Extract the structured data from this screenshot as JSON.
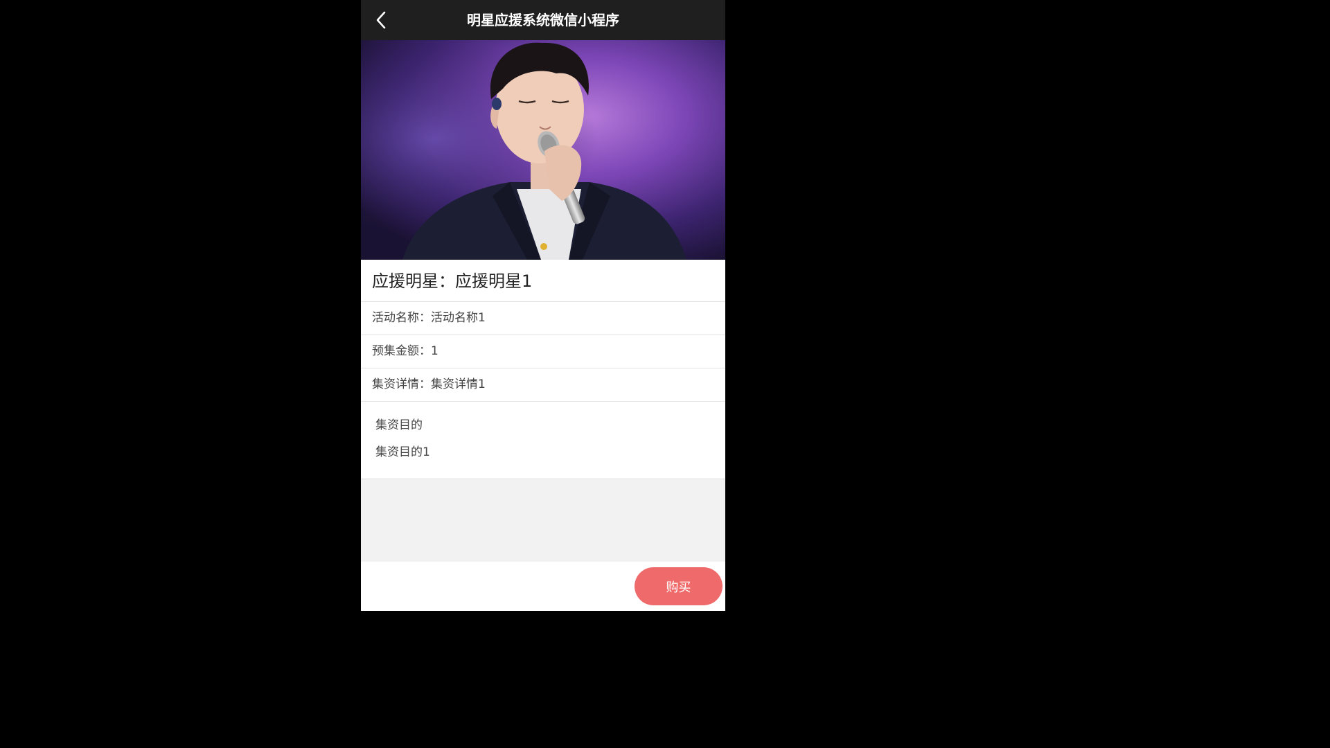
{
  "nav": {
    "title": "明星应援系统微信小程序"
  },
  "hero": {
    "image_alt": "singer performing with microphone on purple stage"
  },
  "detail": {
    "star_line": "应援明星：应援明星1",
    "activity_line": "活动名称：活动名称1",
    "amount_line": "预集金额：1",
    "funding_detail_line": "集资详情：集资详情1",
    "purpose_label": "集资目的",
    "purpose_value": "集资目的1"
  },
  "footer": {
    "buy_label": "购买"
  },
  "colors": {
    "nav_bg": "#1f1f1f",
    "buy_button": "#ef6a6a",
    "page_bg": "#f2f2f2"
  }
}
